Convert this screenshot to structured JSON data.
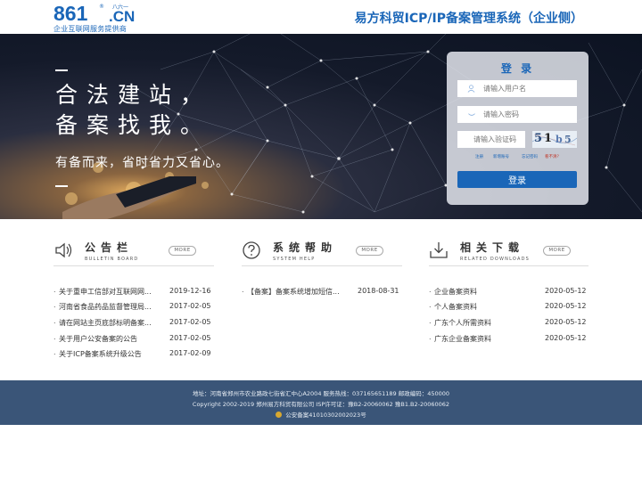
{
  "header": {
    "logo_number": "861",
    "logo_reg": "®",
    "logo_cn": ".CN",
    "logo_cn_sub": "八六一",
    "logo_tagline": "企业互联网服务提供商",
    "site_title": "易方科贸ICP/IP备案管理系统（企业侧）"
  },
  "banner": {
    "slogan_line1": "合法建站，",
    "slogan_line2": "备案找我。",
    "slogan_sub": "有备而来，省时省力又省心。"
  },
  "login": {
    "title": "登 录",
    "username_placeholder": "请输入用户名",
    "password_placeholder": "请输入密码",
    "captcha_placeholder": "请输入验证码",
    "captcha_chars": [
      "5",
      "1",
      "b",
      "5"
    ],
    "links": [
      "注册",
      "新增账号",
      "忘记密码",
      "看不清?"
    ],
    "login_label": "登录"
  },
  "sections": {
    "bulletin": {
      "title": "公告栏",
      "subtitle": "BULLETIN BOARD",
      "more": "MORE",
      "items": [
        {
          "text": "关于重申工信部对互联网网...",
          "date": "2019-12-16"
        },
        {
          "text": "河南省食品药品监督管理局...",
          "date": "2017-02-05"
        },
        {
          "text": "请在网站主页底部标明备案...",
          "date": "2017-02-05"
        },
        {
          "text": "关于用户公安备案的公告",
          "date": "2017-02-05"
        },
        {
          "text": "关于ICP备案系统升级公告",
          "date": "2017-02-09"
        }
      ]
    },
    "help": {
      "title": "系统帮助",
      "subtitle": "SYSTEM HELP",
      "more": "MORE",
      "items": [
        {
          "text": "【备案】备案系统增加短信...",
          "date": "2018-08-31"
        }
      ]
    },
    "downloads": {
      "title": "相关下载",
      "subtitle": "RELATED DOWNLOADS",
      "more": "MORE",
      "items": [
        {
          "text": "企业备案资料",
          "date": "2020-05-12"
        },
        {
          "text": "个人备案资料",
          "date": "2020-05-12"
        },
        {
          "text": "广东个人所需资料",
          "date": "2020-05-12"
        },
        {
          "text": "广东企业备案资料",
          "date": "2020-05-12"
        }
      ]
    }
  },
  "footer": {
    "line1": "地址：河南省郑州市农业路政七街省汇中心A2004    服务热线：037165651189    邮政编码：450000",
    "line2": "Copyright 2002-2019 郑州易方科贸有限公司    ISP许可证：豫B2-20060062    豫B1.B2-20060062",
    "line3": "公安备案41010302002023号"
  },
  "colors": {
    "brand_blue": "#1a66b8",
    "footer_bg": "#3a5578"
  }
}
